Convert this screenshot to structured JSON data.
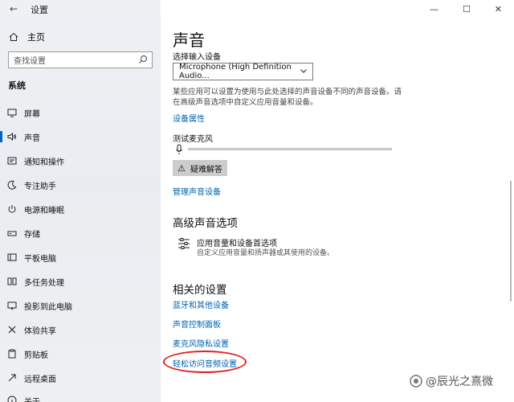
{
  "window": {
    "title": "设置",
    "back_icon": "back-arrow-icon",
    "controls": [
      "—",
      "☐",
      "✕"
    ]
  },
  "sidebar": {
    "home_label": "主页",
    "search_placeholder": "查找设置",
    "group_label": "系统",
    "items": [
      {
        "label": "屏幕",
        "icon": "monitor-icon",
        "active": false
      },
      {
        "label": "声音",
        "icon": "speaker-icon",
        "active": true
      },
      {
        "label": "通知和操作",
        "icon": "notification-icon",
        "active": false
      },
      {
        "label": "专注助手",
        "icon": "moon-icon",
        "active": false
      },
      {
        "label": "电源和睡眠",
        "icon": "power-icon",
        "active": false
      },
      {
        "label": "存储",
        "icon": "storage-icon",
        "active": false
      },
      {
        "label": "平板电脑",
        "icon": "tablet-icon",
        "active": false
      },
      {
        "label": "多任务处理",
        "icon": "multitask-icon",
        "active": false
      },
      {
        "label": "投影到此电脑",
        "icon": "projector-icon",
        "active": false
      },
      {
        "label": "体验共享",
        "icon": "share-icon",
        "active": false
      },
      {
        "label": "剪贴板",
        "icon": "clipboard-icon",
        "active": false
      },
      {
        "label": "远程桌面",
        "icon": "remote-desktop-icon",
        "active": false
      },
      {
        "label": "关于",
        "icon": "info-icon",
        "active": false
      }
    ]
  },
  "main": {
    "title": "声音",
    "input_device_label": "选择输入设备",
    "input_device_value": "Microphone (High Definition Audio...",
    "info_text": "某些应用可以设置为使用与此处选择的声音设备不同的声音设备。请在高级声音选项中自定义应用音量和设备。",
    "device_properties_link": "设备属性",
    "test_mic_label": "测试麦克风",
    "mic_level": 0,
    "troubleshoot_label": "疑难解答",
    "manage_devices_link": "管理声音设备",
    "advanced_title": "高级声音选项",
    "advanced_item_title": "应用音量和设备首选项",
    "advanced_item_desc": "自定义应用音量和扬声器或其使用的设备。",
    "related_title": "相关的设置",
    "related_links": [
      "蓝牙和其他设备",
      "声音控制面板",
      "麦克风隐私设置",
      "轻松访问音频设置"
    ]
  },
  "watermark": {
    "text": "@辰光之熹微"
  },
  "colors": {
    "accent": "#0067c0",
    "link": "#0063b1",
    "highlight_circle": "#e02020"
  }
}
